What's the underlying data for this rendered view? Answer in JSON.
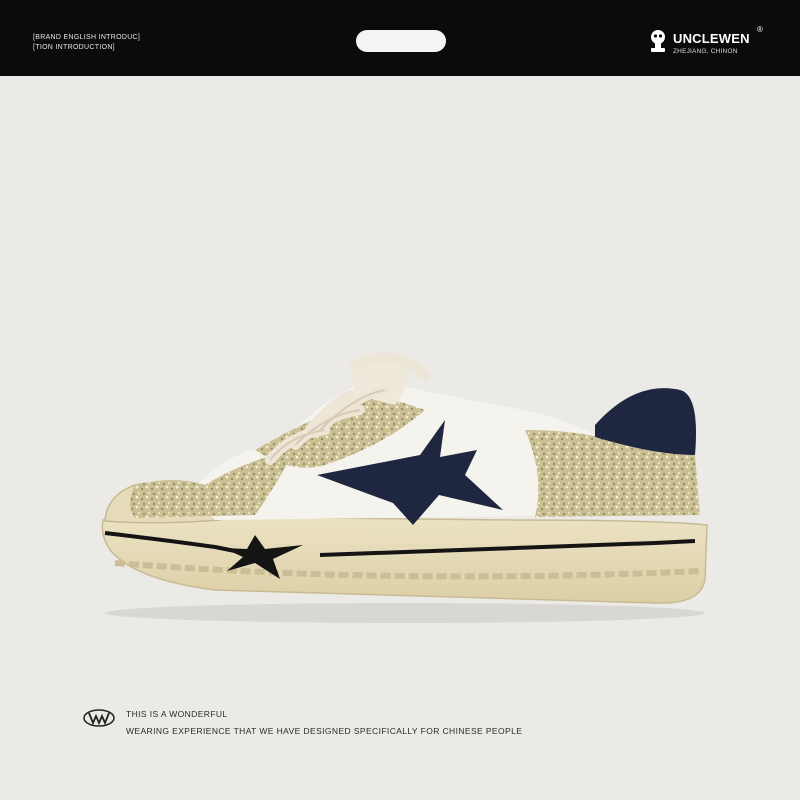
{
  "header": {
    "intro_line1": "[BRAND ENGLISH INTRODUC]",
    "intro_line2": "[TION INTRODUCTION]",
    "brand_name": "UNCLEWEN",
    "brand_registered": "®",
    "brand_location": "ZHEJIANG, CHINON"
  },
  "product": {
    "image": "sneaker-photo",
    "colors": {
      "background": "#ebeae6",
      "header_bar": "#0b0b0b",
      "navy_suede": "#1f2740",
      "glitter_gold": "#cfc49a",
      "sole_cream": "#e6dbb8",
      "upper_white": "#f5f3ee"
    }
  },
  "caption": {
    "line1": "THIS IS A WONDERFUL",
    "line2": "WEARING EXPERIENCE THAT WE HAVE DESIGNED SPECIFICALLY FOR CHINESE PEOPLE"
  }
}
